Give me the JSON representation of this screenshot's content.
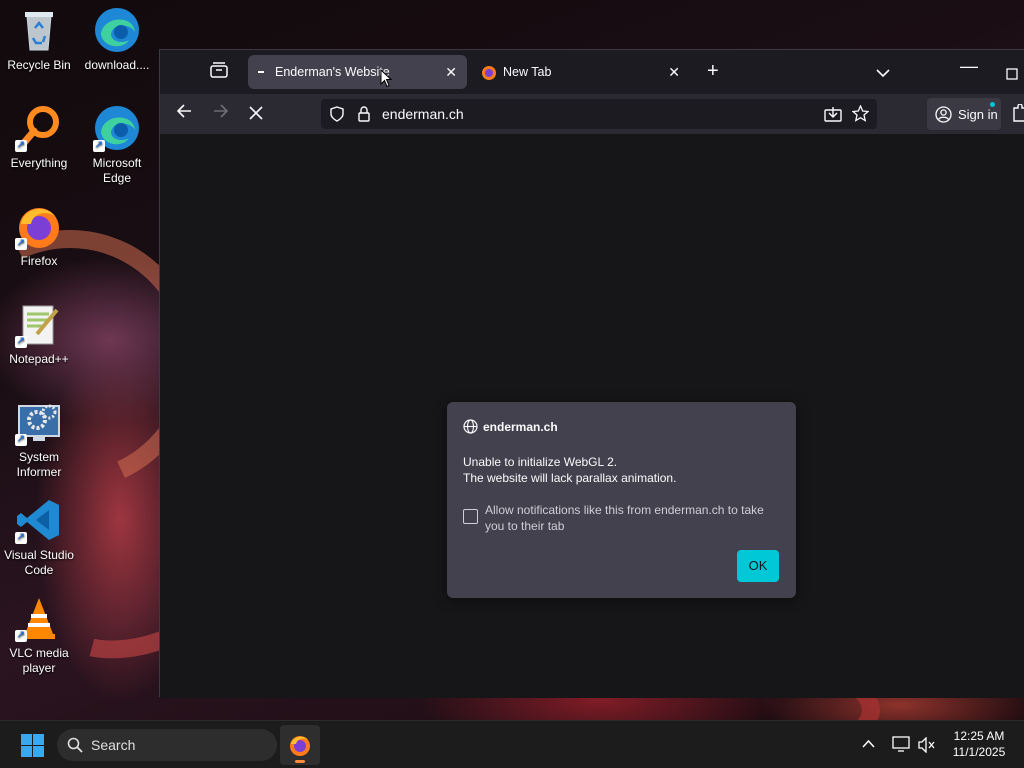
{
  "desktop": {
    "icons": [
      {
        "label": "Recycle Bin",
        "icon": "recycle-bin-icon"
      },
      {
        "label": "download....",
        "icon": "edge-icon"
      },
      {
        "label": "Everything",
        "icon": "search-magnifier-icon"
      },
      {
        "label": "Microsoft Edge",
        "icon": "edge-icon"
      },
      {
        "label": "Firefox",
        "icon": "firefox-icon"
      },
      {
        "label": "Notepad++",
        "icon": "notepadpp-icon"
      },
      {
        "label": "System Informer",
        "icon": "system-informer-icon"
      },
      {
        "label": "Visual Studio Code",
        "icon": "vscode-icon"
      },
      {
        "label": "VLC media player",
        "icon": "vlc-icon"
      }
    ]
  },
  "browser": {
    "tabs": [
      {
        "title": "Enderman's Website",
        "active": true,
        "loading": true
      },
      {
        "title": "New Tab",
        "active": false
      }
    ],
    "url": "enderman.ch",
    "sign_in_label": "Sign in"
  },
  "dialog": {
    "site": "enderman.ch",
    "message_line1": "Unable to initialize WebGL 2.",
    "message_line2": "The website will lack parallax animation.",
    "checkbox_label": "Allow notifications like this from enderman.ch to take you to their tab",
    "checkbox_checked": false,
    "ok_label": "OK"
  },
  "taskbar": {
    "search_placeholder": "Search",
    "time": "12:25 AM",
    "date": "11/1/2025"
  },
  "colors": {
    "accent": "#00c8d7",
    "dialog_bg": "#42414d",
    "toolbar_bg": "#2b2a33"
  }
}
